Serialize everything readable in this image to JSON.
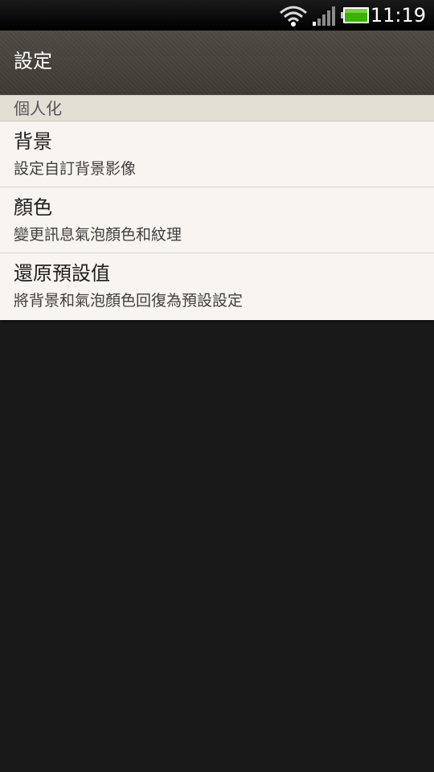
{
  "status_bar": {
    "time": "11:19",
    "icons": [
      "wifi-icon",
      "signal-icon",
      "battery-icon"
    ],
    "battery_color": "#39b200"
  },
  "header": {
    "title": "設定"
  },
  "section": {
    "label": "個人化"
  },
  "items": [
    {
      "title": "背景",
      "subtitle": "設定自訂背景影像"
    },
    {
      "title": "顏色",
      "subtitle": "變更訊息氣泡顏色和紋理"
    },
    {
      "title": "還原預設值",
      "subtitle": "將背景和氣泡顏色回復為預設設定"
    }
  ],
  "colors": {
    "list_background": "#f8f4ef",
    "section_background": "#e2dfd5",
    "page_background": "#191919"
  }
}
